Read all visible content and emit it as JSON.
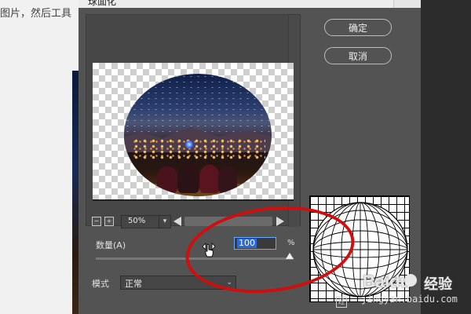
{
  "background": {
    "left_text": "图片，然后工具"
  },
  "dialog": {
    "title": "球面化",
    "buttons": {
      "ok_label": "确定",
      "cancel_label": "取消"
    },
    "preview": {
      "zoom_out_symbol": "−",
      "zoom_in_symbol": "+",
      "zoom_value": "50%"
    },
    "amount": {
      "label": "数量(A)",
      "value": "100",
      "unit": "%",
      "slider_fraction": 1.0
    },
    "mode": {
      "label": "模式",
      "selected": "正常"
    }
  },
  "watermark": {
    "logo_text": "Baidu",
    "suffix_text": "经验",
    "url": "jingyan.baidu.com"
  },
  "colors": {
    "dialog_bg": "#535353",
    "annotation_red": "#d10d0d",
    "highlight_blue": "#2e6bd6"
  }
}
